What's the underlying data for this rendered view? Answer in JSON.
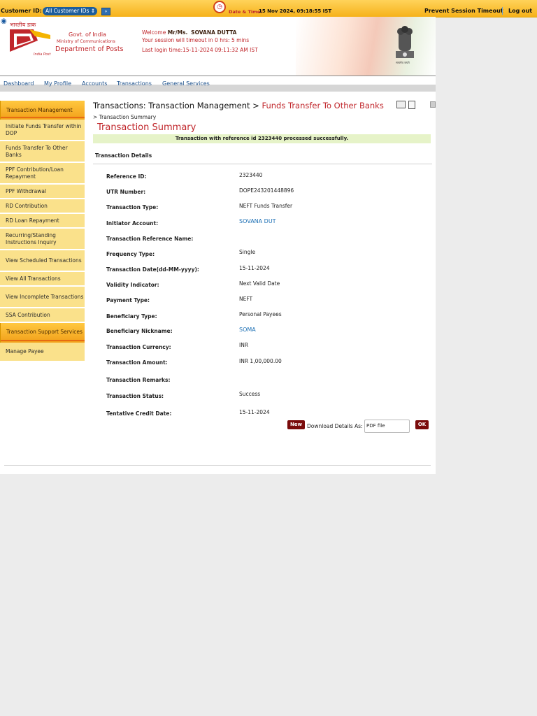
{
  "topbar": {
    "customer_id_label": "Customer ID:",
    "customer_select": "All Customer IDs",
    "go_icon": "go-icon",
    "clock_icon": "clock-icon",
    "datetime_label": "Date & Time:",
    "datetime_value": "15 Nov 2024, 09:18:55 IST",
    "prevent_timeout": "Prevent Session Timeout",
    "logout": "Log out",
    "accent": "#f6b21a"
  },
  "header": {
    "hindi_text": "भारतीय डाक",
    "indiapost": "India Post",
    "govt": "Govt. of India",
    "ministry": "Ministry of Communications",
    "dept": "Department of Posts",
    "welcome_prefix": "Welcome",
    "salutation": "Mr/Ms.",
    "user_name": "SOVANA DUTTA",
    "session_text": "Your session will timeout in 0 hrs: 5 mins",
    "last_login": "Last login time:15-11-2024 09:11:32 AM IST",
    "emblem_text": "सत्यमेव जयते",
    "brand_color": "#c0262b"
  },
  "nav": {
    "items": [
      "Dashboard",
      "My Profile",
      "Accounts",
      "Transactions",
      "General Services"
    ]
  },
  "sidebar": {
    "section1": "Transaction Management",
    "items1": [
      "Initiate Funds Transfer within DOP",
      "Funds Transfer To Other Banks",
      "PPF Contribution/Loan Repayment",
      "PPF Withdrawal",
      "RD Contribution",
      "RD Loan Repayment",
      "Recurring/Standing Instructions Inquiry",
      "View Scheduled Transactions",
      "View All Transactions",
      "View Incomplete Transactions",
      "SSA Contribution"
    ],
    "section2": "Transaction Support Services",
    "items2": [
      "Manage Payee"
    ]
  },
  "breadcrumb": {
    "part1": "Transactions: Transaction Management >",
    "part2": "Funds Transfer To Other Banks",
    "part3": "> Transaction Summary"
  },
  "main": {
    "title": "Transaction Summary",
    "success_message": "Transaction with reference id 2323440 processed successfully.",
    "details_heading": "Transaction Details",
    "fields": [
      {
        "label": "Reference ID:",
        "value": "2323440"
      },
      {
        "label": "UTR Number:",
        "value": "DOPE243201448896"
      },
      {
        "label": "Transaction Type:",
        "value": "NEFT Funds Transfer"
      },
      {
        "label": "Initiator Account:",
        "value": "SOVANA DUT"
      },
      {
        "label": "Transaction Reference Name:",
        "value": ""
      },
      {
        "label": "Frequency Type:",
        "value": "Single"
      },
      {
        "label": "Transaction Date(dd-MM-yyyy):",
        "value": "15-11-2024"
      },
      {
        "label": "Validity Indicator:",
        "value": "Next Valid Date"
      },
      {
        "label": "Payment Type:",
        "value": "NEFT"
      },
      {
        "label": "Beneficiary Type:",
        "value": "Personal Payees"
      },
      {
        "label": "Beneficiary Nickname:",
        "value": "SOMA"
      },
      {
        "label": "Transaction Currency:",
        "value": "INR"
      },
      {
        "label": "Transaction Amount:",
        "value": "INR 1,00,000.00"
      },
      {
        "label": "Transaction Remarks:",
        "value": ""
      },
      {
        "label": "Transaction Status:",
        "value": "Success"
      },
      {
        "label": "Tentative Credit Date:",
        "value": "15-11-2024"
      }
    ],
    "new_button": "New",
    "download_label": "Download Details As:",
    "download_select": "PDF file",
    "ok_button": "OK"
  }
}
